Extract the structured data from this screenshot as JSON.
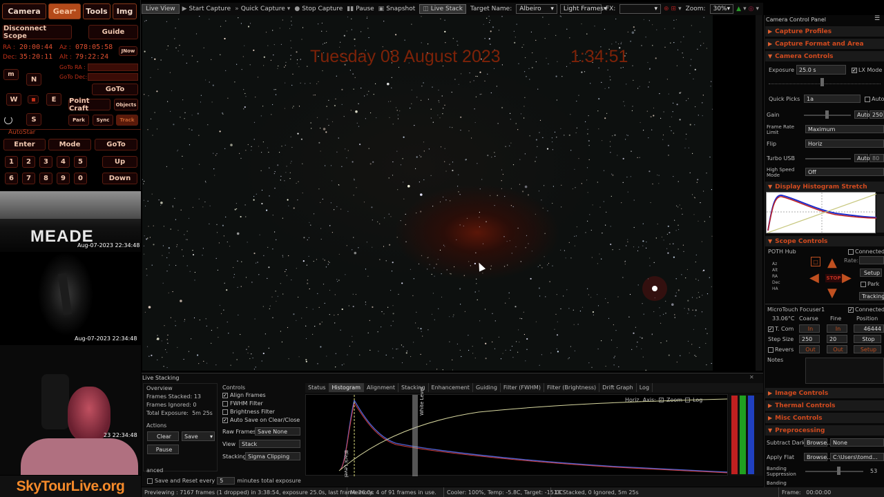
{
  "left_panel": {
    "tabs": [
      "Camera",
      "Gear",
      "Tools",
      "Img"
    ],
    "disconnect_label": "Disconnect Scope",
    "guide_label": "Guide",
    "ra_label": "RA :",
    "ra_value": "20:00:44",
    "az_label": "Az :",
    "az_value": "078:05:58",
    "dec_label": "Dec:",
    "dec_value": "35:20:11",
    "alt_label": "Alt :",
    "alt_value": "79:22:24",
    "jnow_label": "JNow",
    "goto_ra_label": "GoTo RA :",
    "goto_dec_label": "GoTo Dec:",
    "speed_label": "m",
    "n_label": "N",
    "w_label": "W",
    "e_label": "E",
    "s_label": "S",
    "goto_label": "GoTo",
    "point_craft_label": "Point Craft",
    "objects_label": "Objects",
    "park_label": "Park",
    "sync_label": "Sync",
    "track_label": "Track",
    "autostar_label": "AutoStar",
    "enter_label": "Enter",
    "mode_label": "Mode",
    "goto2_label": "GoTo",
    "keypad": [
      "1",
      "2",
      "3",
      "4",
      "5",
      "6",
      "7",
      "8",
      "9",
      "0"
    ],
    "up_label": "Up",
    "down_label": "Down"
  },
  "webcams": {
    "cam1_brand": "MEADE",
    "cam1_timestamp": "Aug-07-2023 22:34:48",
    "cam2_timestamp": "Aug-07-2023 22:34:48",
    "cam3_timestamp": "23 22:34:48",
    "site_name": "SkyTourLive.org"
  },
  "toolbar": {
    "live_view": "Live View",
    "start_capture": "Start Capture",
    "quick_capture": "Quick Capture",
    "stop_capture": "Stop Capture",
    "pause": "Pause",
    "snapshot": "Snapshot",
    "live_stack": "Live Stack",
    "target_name_label": "Target Name:",
    "target_name_value": "Albeiro",
    "light_frames": "Light Frames",
    "fx_label": "FX:",
    "zoom_label": "Zoom:",
    "zoom_value": "30%"
  },
  "image": {
    "date_overlay": "Tuesday 08 August 2023",
    "time_overlay": "1:34:51"
  },
  "right_panel": {
    "title": "Camera Control Panel",
    "capture_profiles": "Capture Profiles",
    "capture_format": "Capture Format and Area",
    "camera_controls": "Camera Controls",
    "exposure_label": "Exposure",
    "exposure_value": "25.0 s",
    "lx_mode": "LX Mode",
    "quick_picks_label": "Quick Picks",
    "quick_picks_value": "1a",
    "auto_label": "Auto",
    "gain_label": "Gain",
    "gain_auto": "Auto",
    "gain_value": "250",
    "frame_rate_label": "Frame Rate Limit",
    "frame_rate_value": "Maximum",
    "flip_label": "Flip",
    "flip_value": "Horiz",
    "turbo_label": "Turbo USB",
    "turbo_auto": "Auto",
    "turbo_value": "80",
    "hs_label": "High Speed Mode",
    "hs_value": "Off",
    "histogram_stretch": "Display Histogram Stretch",
    "scope_controls": "Scope Controls",
    "poth_hub": "POTH Hub",
    "connected": "Connected",
    "rate_label": "Rate:",
    "stop_label": "STOP",
    "setup_label": "Setup",
    "park_label": "Park",
    "tracking_label": "Tracking",
    "scope_fields": [
      "Az",
      "Alt",
      "RA",
      "Dec",
      "HA"
    ],
    "focuser_name": "MicroTouch Focuser1",
    "focuser_connected": "Connected",
    "temp_value": "33.06°C",
    "coarse_label": "Coarse",
    "fine_label": "Fine",
    "position_label": "Position",
    "tcomp_label": "T. Com",
    "in_label": "In",
    "position_value": "46444",
    "step_size_label": "Step Size",
    "step_coarse": "250",
    "step_fine": "20",
    "stop2_label": "Stop",
    "reverse_label": "Revers",
    "out_label": "Out",
    "setup2_label": "Setup",
    "notes_label": "Notes",
    "image_controls": "Image Controls",
    "thermal_controls": "Thermal Controls",
    "misc_controls": "Misc Controls",
    "preprocessing": "Preprocessing",
    "subtract_dark": "Subtract Dark",
    "browse": "Browse...",
    "dark_value": "None",
    "apply_flat": "Apply Flat",
    "flat_value": "C:\\Users\\tomd...",
    "banding_label": "Banding Suppression",
    "banding_value": "53",
    "banding2_label": "Banding"
  },
  "live_stacking": {
    "title": "Live Stacking",
    "overview": "Overview",
    "frames_stacked_label": "Frames Stacked:",
    "frames_stacked_value": "13",
    "frames_ignored_label": "Frames Ignored:",
    "frames_ignored_value": "0",
    "total_exposure_label": "Total Exposure:",
    "total_exposure_value": "5m 25s",
    "actions": "Actions",
    "clear": "Clear",
    "save": "Save",
    "pause": "Pause",
    "advanced": "anced",
    "save_reset_label": "Save and Reset every",
    "save_reset_value": "5",
    "minutes_label": "minutes total exposure",
    "controls": "Controls",
    "align_frames": "Align Frames",
    "fwhm_filter": "FWHM Filter",
    "brightness_filter": "Brightness Filter",
    "auto_save": "Auto Save on Clear/Close",
    "raw_frames_label": "Raw Frames",
    "raw_frames_value": "Save None",
    "view_label": "View",
    "view_value": "Stack",
    "stacking_label": "Stacking",
    "stacking_value": "Sigma Clipping",
    "tabs": [
      "Status",
      "Histogram",
      "Alignment",
      "Stacking",
      "Enhancement",
      "Guiding",
      "Filter (FWHM)",
      "Filter (Brightness)",
      "Drift Graph",
      "Log"
    ],
    "horiz_axis_label": "Horiz. Axis:",
    "zoom_label": "Zoom",
    "log_label": "Log",
    "black_level": "Black Level",
    "white_level": "White Level"
  },
  "status_bar": {
    "previewing": "Previewing : 7167 frames (1 dropped) in 3:38:54, exposure 25.0s, last frame 26.0s",
    "memory": "Memory: 4 of 91 frames in use.",
    "cooler": "Cooler: 100%, Temp: -5.8C, Target: -15.0C",
    "stacked": "13 Stacked, 0 Ignored, 5m 25s",
    "frame_label": "Frame:",
    "frame_value": "00:00:00"
  },
  "colors": {
    "accent_red": "#d24a1e",
    "overlay_text": "#b02a0a",
    "sky_bg": "#0d100f"
  }
}
